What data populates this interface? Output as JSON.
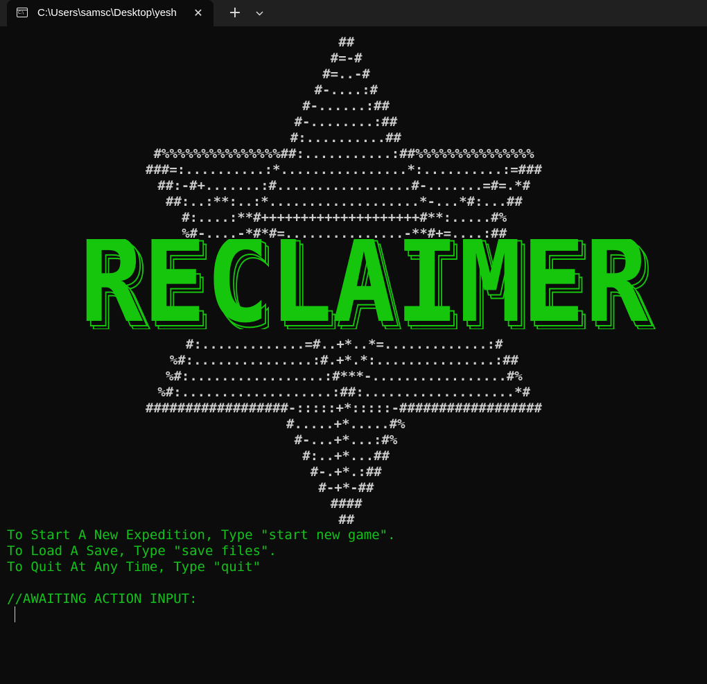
{
  "window": {
    "tab_title": "C:\\Users\\samsc\\Desktop\\yesh",
    "tab_icon": "terminal-icon",
    "close_icon": "close-icon",
    "new_tab_label": "+",
    "dropdown_icon": "chevron-down-icon"
  },
  "art_top": [
    "##",
    "#=-#",
    "#=..-#",
    "#-....:#",
    "#-......:##",
    "#-........:##",
    "#:..........##",
    "#%%%%%%%%%%%%%%%##:...........:##%%%%%%%%%%%%%%%",
    "###=:..........:*................*:..........:=###",
    "##:-#+.......:#.................#-.......=#=.*#",
    "##:..:**:..:*...................*-...*#:...##",
    "#:....:**#++++++++++++++++++++#**:.....#%",
    "%#-....-*#*#=...............-**#+=....:##"
  ],
  "logo_text": "RECLAIMER",
  "art_bottom": [
    "#:.............=#..+*..*=.............:#",
    "%#:...............:#.+*.*:...............:##",
    "%#:.................:#***-.................#%",
    "%#:...................:##:...................*#",
    "##################-:::::+*:::::-##################",
    "#.....+*.....#%",
    "#-...+*...:#%",
    "#:..+*...##",
    "#-.+*.:##",
    "#-+*-##",
    "####",
    "##"
  ],
  "menu": {
    "line1": "To Start A New Expedition, Type \"start new game\".",
    "line2": "To Load A Save, Type \"save files\".",
    "line3": "To Quit At Any Time, Type \"quit\"",
    "prompt": "//AWAITING ACTION INPUT:"
  },
  "colors": {
    "background": "#0c0c0c",
    "tabbar": "#202020",
    "text": "#cccccc",
    "accent_green": "#13c21a",
    "logo_green": "#16c60c"
  }
}
